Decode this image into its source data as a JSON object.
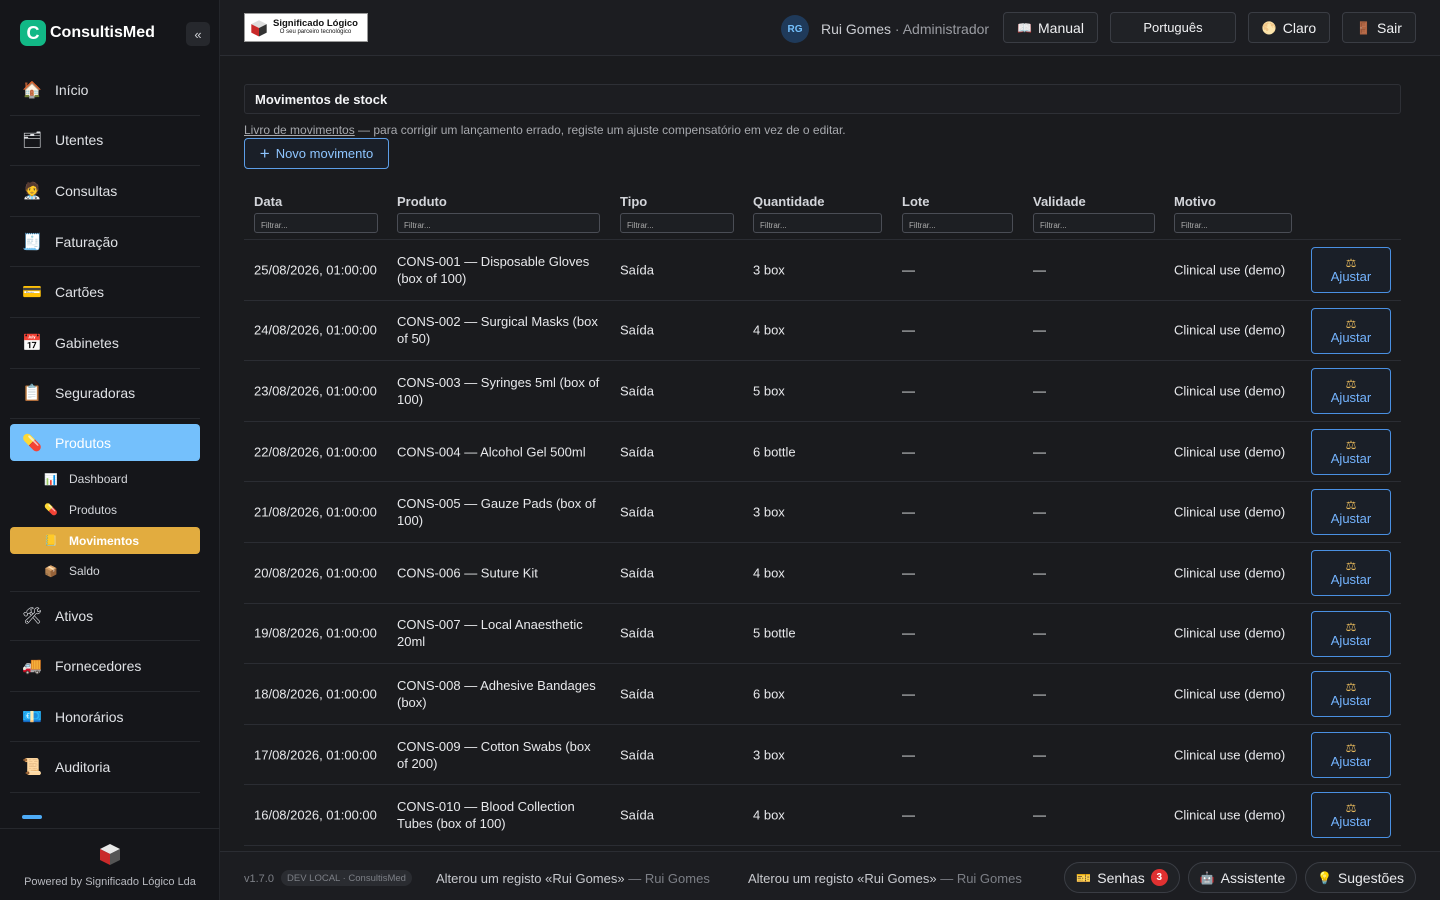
{
  "sidebar": {
    "brand": "ConsultisMed",
    "collapse_icon": "«",
    "items": [
      {
        "label": "Início",
        "icon": "🏠"
      },
      {
        "label": "Utentes",
        "icon": "🗂"
      },
      {
        "label": "Consultas",
        "icon": "🧑‍⚕"
      },
      {
        "label": "Faturação",
        "icon": "🧾"
      },
      {
        "label": "Cartões",
        "icon": "💳"
      },
      {
        "label": "Gabinetes",
        "icon": "📅"
      },
      {
        "label": "Seguradoras",
        "icon": "📋"
      },
      {
        "label": "Produtos",
        "icon": "💊"
      }
    ],
    "sub_items": [
      {
        "label": "Dashboard",
        "icon": "📊"
      },
      {
        "label": "Produtos",
        "icon": "💊"
      },
      {
        "label": "Movimentos",
        "icon": "📒"
      },
      {
        "label": "Saldo",
        "icon": "📦"
      }
    ],
    "items_after": [
      {
        "label": "Ativos",
        "icon": "🛠"
      },
      {
        "label": "Fornecedores",
        "icon": "🚚"
      },
      {
        "label": "Honorários",
        "icon": "💶"
      },
      {
        "label": "Auditoria",
        "icon": "📜"
      }
    ],
    "footer": "Powered by Significado Lógico Lda"
  },
  "topbar": {
    "client_logo_title": "Significado Lógico",
    "client_logo_tagline": "O seu parceiro tecnológico",
    "avatar_initials": "RG",
    "user_name": "Rui Gomes",
    "user_role": "· Administrador",
    "manual_label": "Manual",
    "manual_icon": "📖",
    "language_label": "Português",
    "theme_label": "Claro",
    "theme_icon": "🌕",
    "logout_label": "Sair",
    "logout_icon": "🚪"
  },
  "page": {
    "title": "Movimentos de stock",
    "hint_link": "Livro de movimentos",
    "hint_text": " — para corrigir um lançamento errado, registe um ajuste compensatório em vez de o editar.",
    "new_button": "Novo movimento",
    "filter_placeholder": "Filtrar..."
  },
  "table": {
    "columns": [
      "Data",
      "Produto",
      "Tipo",
      "Quantidade",
      "Lote",
      "Validade",
      "Motivo"
    ],
    "action_label": "Ajustar",
    "action_icon": "⚖",
    "rows": [
      {
        "data": "25/08/2026, 01:00:00",
        "produto": "CONS-001 — Disposable Gloves (box of 100)",
        "tipo": "Saída",
        "quantidade": "3 box",
        "lote": "—",
        "validade": "—",
        "motivo": "Clinical use (demo)"
      },
      {
        "data": "24/08/2026, 01:00:00",
        "produto": "CONS-002 — Surgical Masks (box of 50)",
        "tipo": "Saída",
        "quantidade": "4 box",
        "lote": "—",
        "validade": "—",
        "motivo": "Clinical use (demo)"
      },
      {
        "data": "23/08/2026, 01:00:00",
        "produto": "CONS-003 — Syringes 5ml (box of 100)",
        "tipo": "Saída",
        "quantidade": "5 box",
        "lote": "—",
        "validade": "—",
        "motivo": "Clinical use (demo)"
      },
      {
        "data": "22/08/2026, 01:00:00",
        "produto": "CONS-004 — Alcohol Gel 500ml",
        "tipo": "Saída",
        "quantidade": "6 bottle",
        "lote": "—",
        "validade": "—",
        "motivo": "Clinical use (demo)"
      },
      {
        "data": "21/08/2026, 01:00:00",
        "produto": "CONS-005 — Gauze Pads (box of 100)",
        "tipo": "Saída",
        "quantidade": "3 box",
        "lote": "—",
        "validade": "—",
        "motivo": "Clinical use (demo)"
      },
      {
        "data": "20/08/2026, 01:00:00",
        "produto": "CONS-006 — Suture Kit",
        "tipo": "Saída",
        "quantidade": "4 box",
        "lote": "—",
        "validade": "—",
        "motivo": "Clinical use (demo)"
      },
      {
        "data": "19/08/2026, 01:00:00",
        "produto": "CONS-007 — Local Anaesthetic 20ml",
        "tipo": "Saída",
        "quantidade": "5 bottle",
        "lote": "—",
        "validade": "—",
        "motivo": "Clinical use (demo)"
      },
      {
        "data": "18/08/2026, 01:00:00",
        "produto": "CONS-008 — Adhesive Bandages (box)",
        "tipo": "Saída",
        "quantidade": "6 box",
        "lote": "—",
        "validade": "—",
        "motivo": "Clinical use (demo)"
      },
      {
        "data": "17/08/2026, 01:00:00",
        "produto": "CONS-009 — Cotton Swabs (box of 200)",
        "tipo": "Saída",
        "quantidade": "3 box",
        "lote": "—",
        "validade": "—",
        "motivo": "Clinical use (demo)"
      },
      {
        "data": "16/08/2026, 01:00:00",
        "produto": "CONS-010 — Blood Collection Tubes (box of 100)",
        "tipo": "Saída",
        "quantidade": "4 box",
        "lote": "—",
        "validade": "—",
        "motivo": "Clinical use (demo)"
      }
    ]
  },
  "bottombar": {
    "version": "v1.7.0",
    "env": "DEV LOCAL · ConsultisMed",
    "activities": [
      {
        "text": "Alterou um registo «Rui Gomes»",
        "by": " — Rui Gomes"
      },
      {
        "text": "Alterou um registo «Rui Gomes»",
        "by": " — Rui Gomes"
      }
    ],
    "senhas_label": "Senhas",
    "senhas_icon": "🎫",
    "senhas_count": "3",
    "assistant_label": "Assistente",
    "assistant_icon": "🤖",
    "suggestions_label": "Sugestões",
    "suggestions_icon": "💡"
  },
  "colors": {
    "active_nav": "#74c0fc",
    "active_sub": "#e2ac3f",
    "accent_blue": "#4a90e2",
    "brand_green": "#12b886",
    "badge_red": "#e03131"
  }
}
